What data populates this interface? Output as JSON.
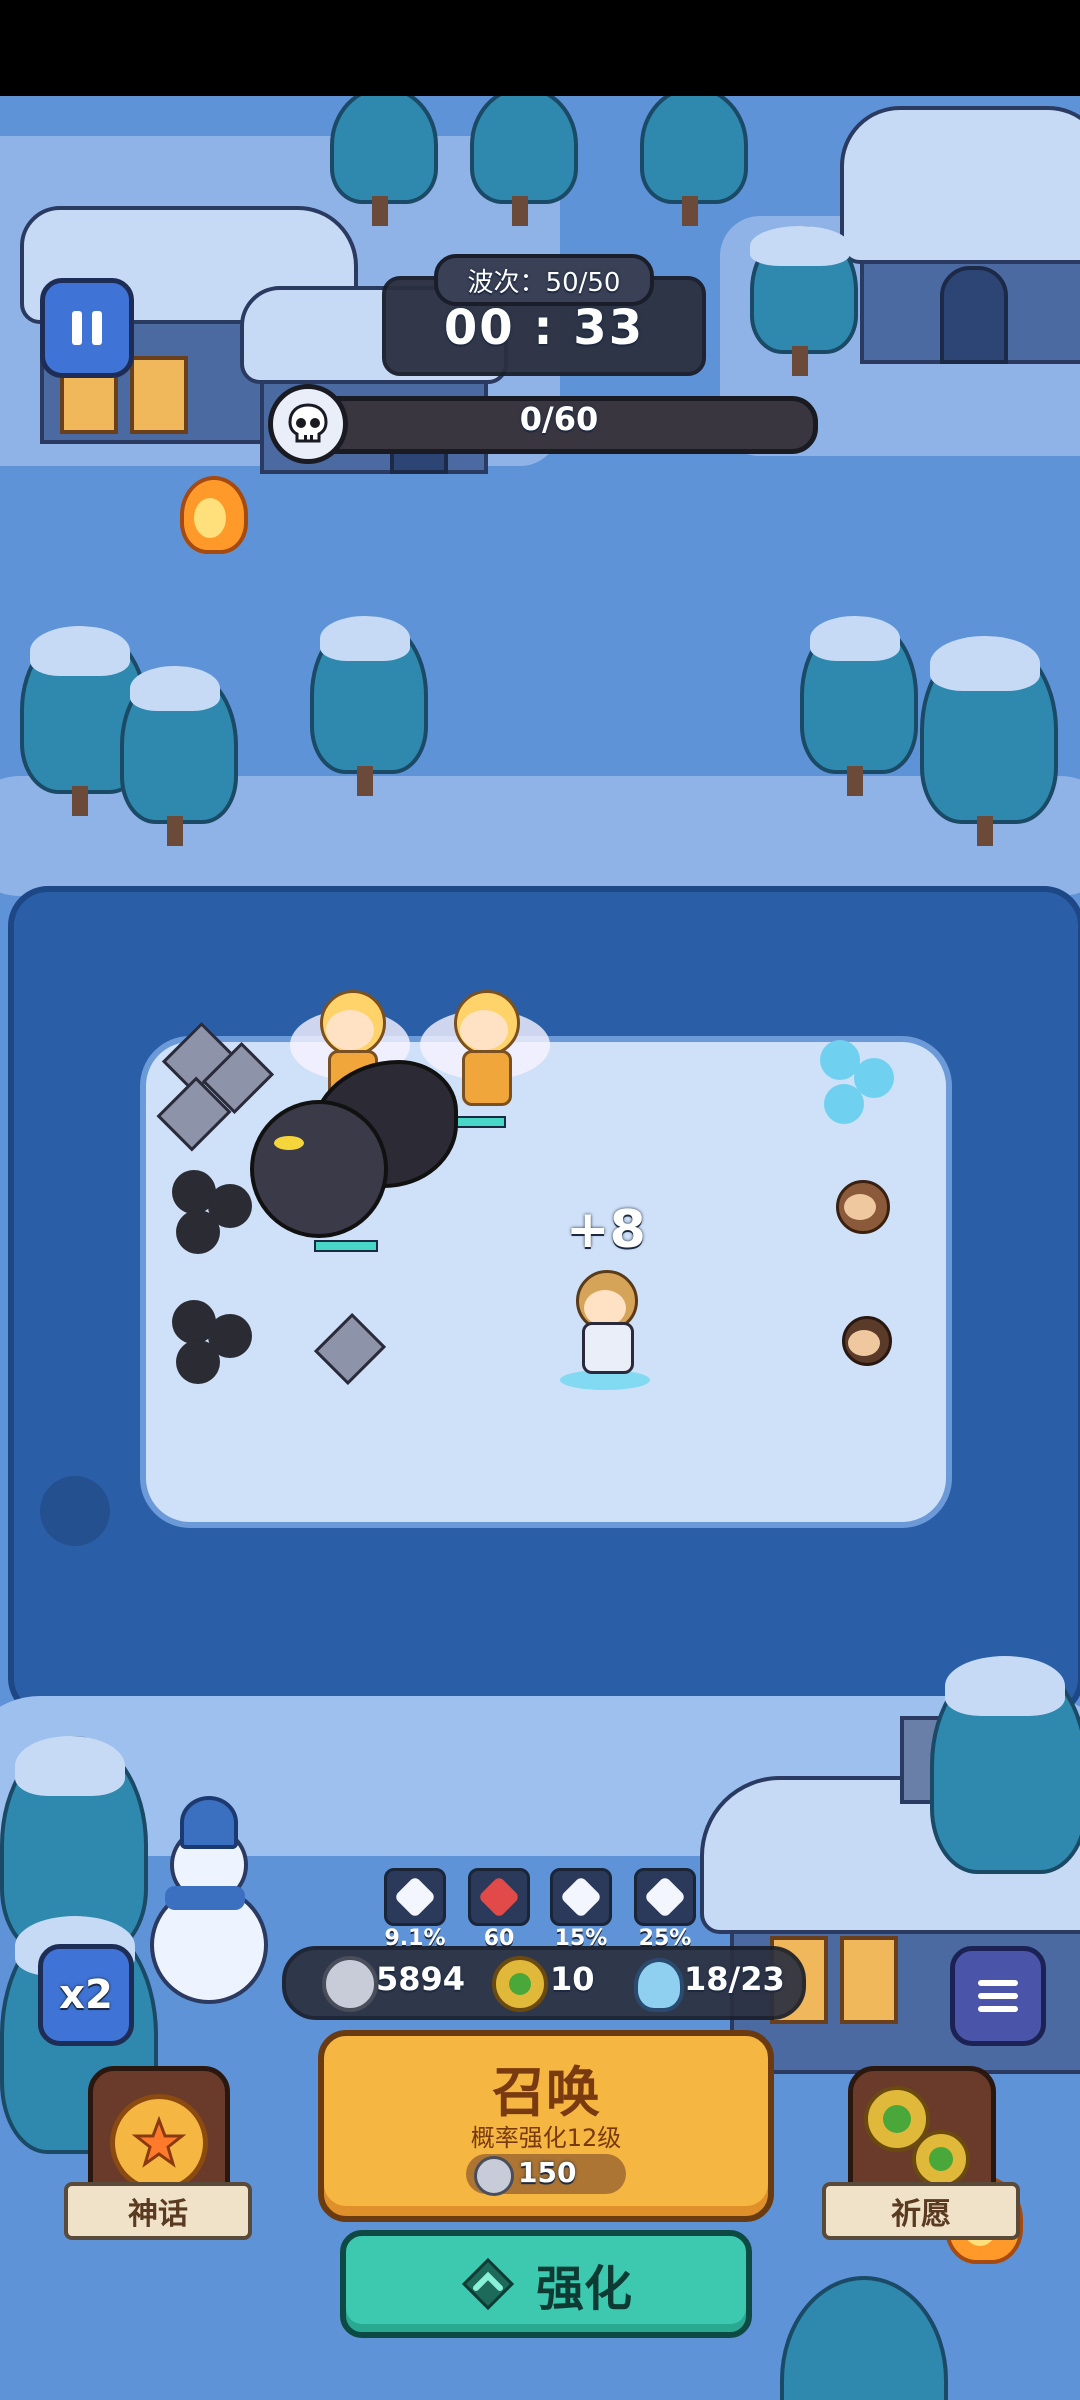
{
  "hud": {
    "wave_label": "波次：50/50",
    "timer": "00 : 33",
    "kill_progress": "0/60",
    "kill_fraction": 0
  },
  "battle": {
    "floating_text": "+8"
  },
  "stats": [
    {
      "icon": "crit-heart-icon",
      "value": "9.1%"
    },
    {
      "icon": "attack-burst-icon",
      "value": "60"
    },
    {
      "icon": "fist-upgrade-icon",
      "value": "15%"
    },
    {
      "icon": "wing-speed-icon",
      "value": "25%"
    }
  ],
  "resources": {
    "silver": "5894",
    "clover": "10",
    "units": "18/23"
  },
  "buttons": {
    "speed": "x2",
    "myth": "神话",
    "wish": "祈愿",
    "summon_title": "召唤",
    "summon_sub": "概率强化12级",
    "summon_cost": "150",
    "upgrade": "强化"
  },
  "colors": {
    "sky_snow": "#5f93d8",
    "summon_gold": "#f5b642",
    "upgrade_teal": "#3cc9b0",
    "hud_dark": "#2b3040"
  }
}
